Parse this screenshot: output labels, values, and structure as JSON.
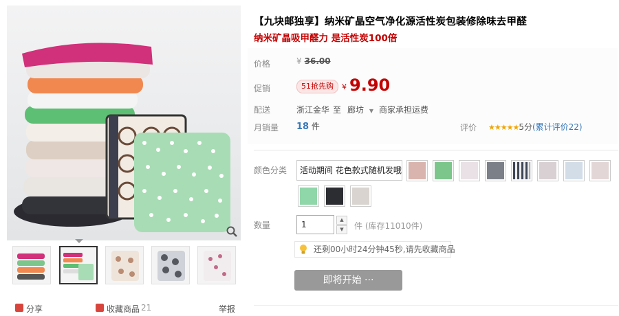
{
  "product": {
    "title": "【九块邮独享】纳米矿晶空气净化源活性炭包装修除味去甲醛",
    "subtitle": "纳米矿晶吸甲醛力 是活性炭100倍"
  },
  "price": {
    "label": "价格",
    "currency": "¥",
    "original": "36.00",
    "promo_label": "促销",
    "promo_tag": "51抢先购",
    "promo_currency": "¥",
    "promo_price": "9.90"
  },
  "shipping": {
    "label": "配送",
    "from": "浙江金华",
    "to_word": "至",
    "to": "廊坊",
    "fee": "商家承担运费"
  },
  "sales": {
    "label": "月销量",
    "count": "18",
    "unit": "件",
    "rating_label": "评价",
    "stars": "★★★★★",
    "score": "5分",
    "reviews": "(累计评价22)"
  },
  "sku": {
    "label": "颜色分类",
    "selected_text": "活动期间 花色款式随机发哦",
    "swatch_colors": [
      "#d9b4ae",
      "#7cc58b",
      "#e9e1e6",
      "#7b8088",
      "#3e4556",
      "#d8d0d3",
      "#d2dde8",
      "#e3d6d6",
      "#8fd6a8",
      "#2c2c33",
      "#d9d4cf"
    ]
  },
  "quantity": {
    "label": "数量",
    "value": "1",
    "unit_stock": "件 (库存11010件)"
  },
  "notice": {
    "text": "还剩00小时24分钟45秒,请先收藏商品"
  },
  "buy_button": {
    "label": "即将开始 ···"
  },
  "share": {
    "share_label": "分享",
    "fav_label": "收藏商品",
    "fav_count": "21",
    "report_label": "举报"
  },
  "colors": {
    "accent_red": "#c40000",
    "link_blue": "#3778b8",
    "star_orange": "#f2a400",
    "button_gray": "#999999"
  }
}
